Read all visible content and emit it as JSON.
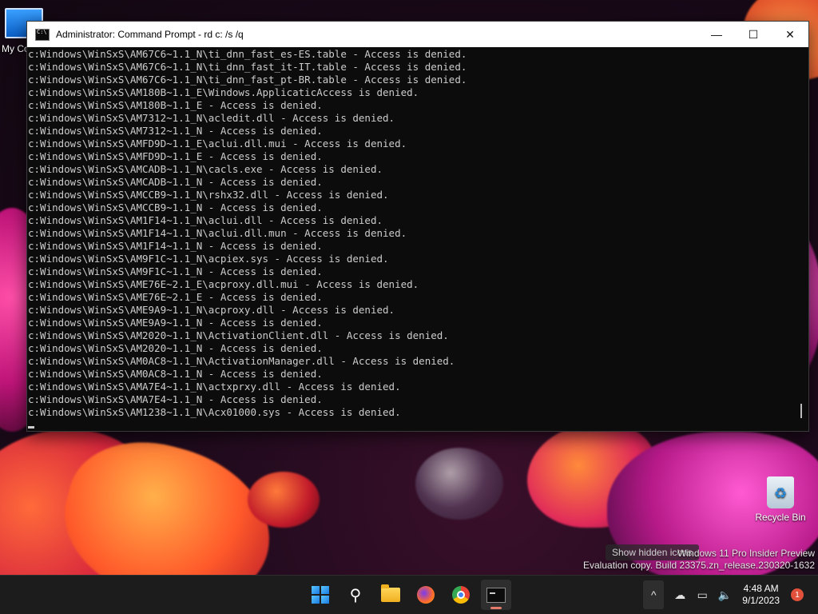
{
  "desktop": {
    "icons": [
      {
        "label": "My Co"
      },
      {
        "label": "Recycle Bin"
      }
    ]
  },
  "window": {
    "title": "Administrator: Command Prompt - rd  c: /s /q",
    "controls": {
      "minimize": "—",
      "maximize": "☐",
      "close": "✕"
    },
    "lines": [
      "c:Windows\\WinSxS\\AM67C6~1.1_N\\ti_dnn_fast_es-ES.table - Access is denied.",
      "c:Windows\\WinSxS\\AM67C6~1.1_N\\ti_dnn_fast_it-IT.table - Access is denied.",
      "c:Windows\\WinSxS\\AM67C6~1.1_N\\ti_dnn_fast_pt-BR.table - Access is denied.",
      "c:Windows\\WinSxS\\AM180B~1.1_E\\Windows.ApplicaticAccess is denied.",
      "c:Windows\\WinSxS\\AM180B~1.1_E - Access is denied.",
      "c:Windows\\WinSxS\\AM7312~1.1_N\\acledit.dll - Access is denied.",
      "c:Windows\\WinSxS\\AM7312~1.1_N - Access is denied.",
      "c:Windows\\WinSxS\\AMFD9D~1.1_E\\aclui.dll.mui - Access is denied.",
      "c:Windows\\WinSxS\\AMFD9D~1.1_E - Access is denied.",
      "c:Windows\\WinSxS\\AMCADB~1.1_N\\cacls.exe - Access is denied.",
      "c:Windows\\WinSxS\\AMCADB~1.1_N - Access is denied.",
      "c:Windows\\WinSxS\\AMCCB9~1.1_N\\rshx32.dll - Access is denied.",
      "c:Windows\\WinSxS\\AMCCB9~1.1_N - Access is denied.",
      "c:Windows\\WinSxS\\AM1F14~1.1_N\\aclui.dll - Access is denied.",
      "c:Windows\\WinSxS\\AM1F14~1.1_N\\aclui.dll.mun - Access is denied.",
      "c:Windows\\WinSxS\\AM1F14~1.1_N - Access is denied.",
      "c:Windows\\WinSxS\\AM9F1C~1.1_N\\acpiex.sys - Access is denied.",
      "c:Windows\\WinSxS\\AM9F1C~1.1_N - Access is denied.",
      "c:Windows\\WinSxS\\AME76E~2.1_E\\acproxy.dll.mui - Access is denied.",
      "c:Windows\\WinSxS\\AME76E~2.1_E - Access is denied.",
      "c:Windows\\WinSxS\\AME9A9~1.1_N\\acproxy.dll - Access is denied.",
      "c:Windows\\WinSxS\\AME9A9~1.1_N - Access is denied.",
      "c:Windows\\WinSxS\\AM2020~1.1_N\\ActivationClient.dll - Access is denied.",
      "c:Windows\\WinSxS\\AM2020~1.1_N - Access is denied.",
      "c:Windows\\WinSxS\\AM0AC8~1.1_N\\ActivationManager.dll - Access is denied.",
      "c:Windows\\WinSxS\\AM0AC8~1.1_N - Access is denied.",
      "c:Windows\\WinSxS\\AMA7E4~1.1_N\\actxprxy.dll - Access is denied.",
      "c:Windows\\WinSxS\\AMA7E4~1.1_N - Access is denied.",
      "c:Windows\\WinSxS\\AM1238~1.1_N\\Acx01000.sys - Access is denied."
    ]
  },
  "watermark": {
    "line1": "Windows 11 Pro Insider Preview",
    "line2": "Evaluation copy. Build 23375.zn_release.230320-1632",
    "tooltip": "Show hidden icons"
  },
  "taskbar": {
    "apps": [
      "start-icon",
      "search-icon",
      "file-explorer-icon",
      "firefox-icon",
      "chrome-icon",
      "terminal-icon"
    ],
    "tray": {
      "chevron": "^",
      "time": "4:48 AM",
      "date": "9/1/2023",
      "notification_count": "1"
    }
  },
  "colors": {
    "console_bg": "#0c0c0c",
    "console_text": "#cccccc",
    "taskbar_bg": "#1c1c1c"
  }
}
